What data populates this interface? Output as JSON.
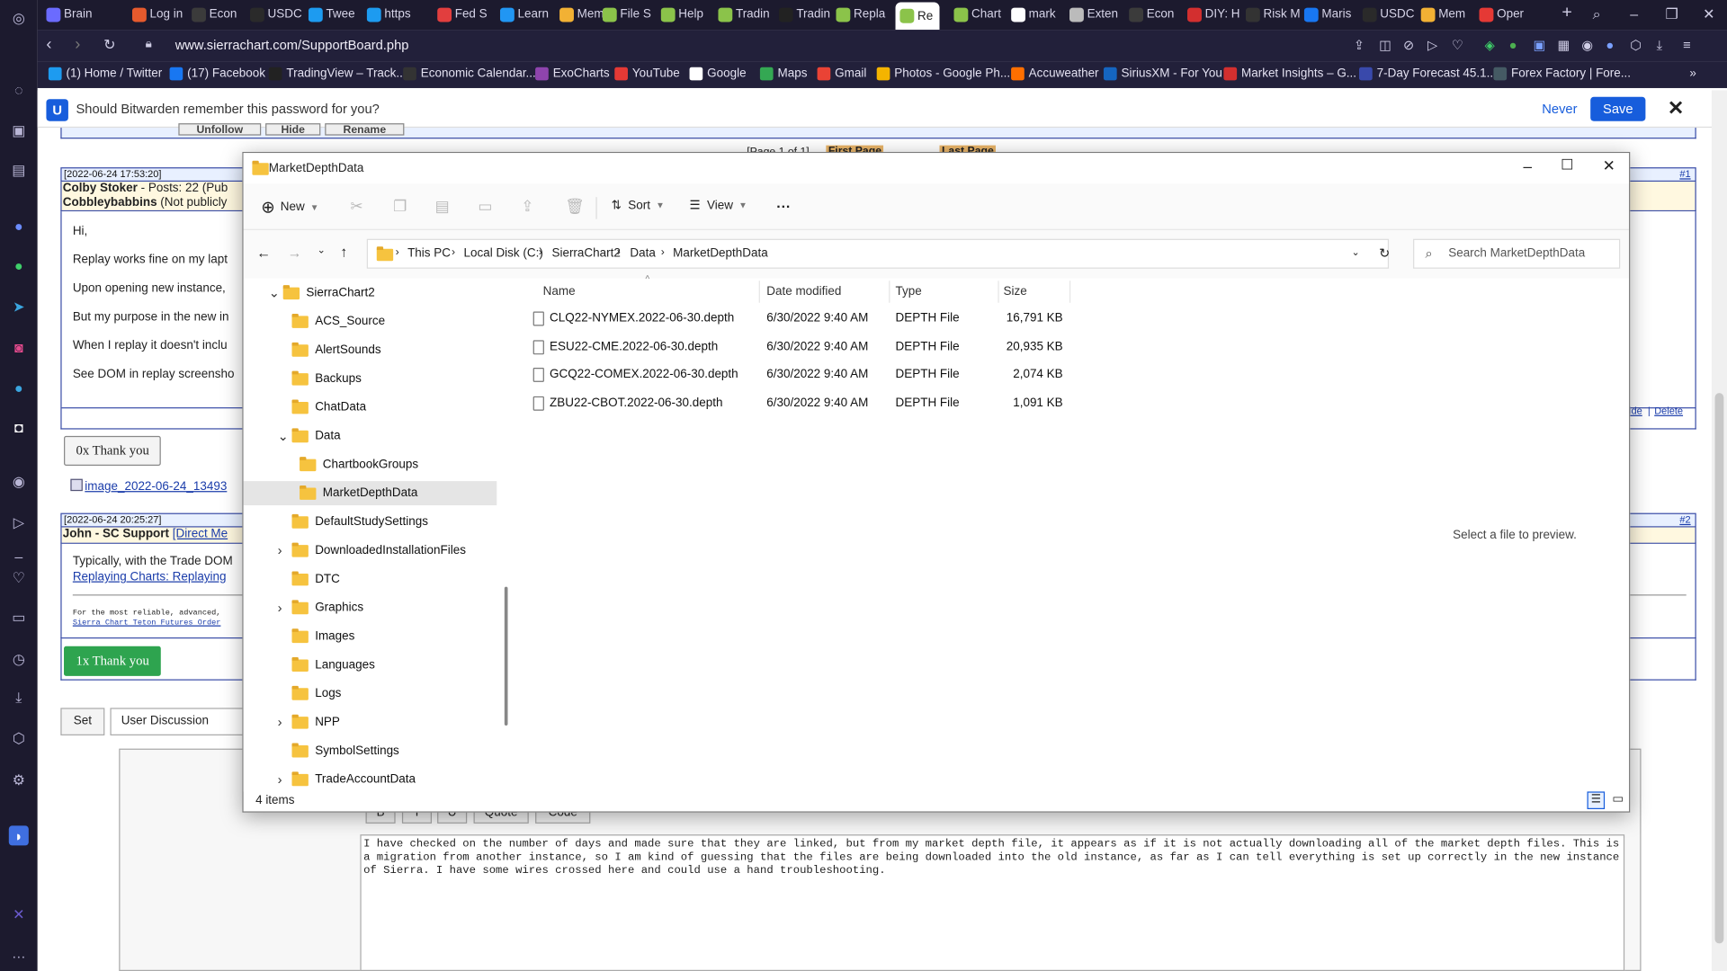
{
  "browser": {
    "tabs": [
      "Brain",
      "Log in",
      "Econ",
      "USDC",
      "Twee",
      "https",
      "Fed S",
      "Learn",
      "Mem",
      "File S",
      "Help",
      "Tradin",
      "Tradin",
      "Repla",
      "Re",
      "Chart",
      "mark",
      "Exten",
      "Econ",
      "DIY: H",
      "Risk M",
      "Maris",
      "USDC",
      "Mem",
      "Oper"
    ],
    "url": "www.sierrachart.com/SupportBoard.php",
    "bookmarks": [
      "(1) Home / Twitter",
      "(17) Facebook",
      "TradingView – Track...",
      "Economic Calendar...",
      "ExoCharts",
      "YouTube",
      "Google",
      "Maps",
      "Gmail",
      "Photos - Google Ph...",
      "Accuweather",
      "SiriusXM - For You",
      "Market Insights – G...",
      "7-Day Forecast 45.1...",
      "Forex Factory | Fore..."
    ]
  },
  "bitwarden": {
    "prompt": "Should Bitwarden remember this password for you?",
    "never_label": "Never",
    "save_label": "Save"
  },
  "page": {
    "top_buttons": [
      "Unfollow",
      "Hide",
      "Rename"
    ],
    "pagination": {
      "text": "[Page 1 of 1]",
      "first": "First Page",
      "last": "Last Page"
    },
    "post1": {
      "timestamp": "[2022-06-24 17:53:20]",
      "num": "#1",
      "author": "Colby Stoker",
      "author_meta": " - Posts: 22 (Pub",
      "author_line2": "Cobbleybabbins",
      "author_line2_meta": " (Not publicly",
      "lines": [
        "Hi,",
        "Replay works fine on my lapt",
        "Upon opening new instance,",
        "But my purpose in the new in",
        "When I replay it doesn't inclu",
        "See DOM in replay screensho"
      ],
      "actions": [
        "ide",
        "Delete"
      ],
      "thank_label": "0x Thank you",
      "attachment": "image_2022-06-24_13493"
    },
    "post2": {
      "timestamp": "[2022-06-24 20:25:27]",
      "num": "#2",
      "author": "John - SC Support",
      "author_link": "[Direct Me",
      "line1": "Typically, with the Trade DOM",
      "link": "Replaying Charts: Replaying",
      "footer1": "For the most reliable, advanced,",
      "footer2": "Sierra Chart Teton Futures Order",
      "thank_label": "1x Thank you"
    },
    "set_label": "Set",
    "select_value": "User Discussion",
    "editor_buttons": [
      "B",
      "I",
      "U",
      "Quote",
      "Code"
    ],
    "reply_text": "I have checked on the number of days and made sure that they are linked, but from my market depth file, it appears as if it is not actually downloading all of the market depth files.  This is a migration from another instance, so I am kind of guessing that the files are being downloaded into the old instance, as far as I can tell everything is set up correctly in the new instance of Sierra. I have some wires crossed here and could use a hand troubleshooting."
  },
  "explorer": {
    "title": "MarketDepthData",
    "commands": {
      "new": "New",
      "sort": "Sort",
      "view": "View",
      "more": "···"
    },
    "breadcrumb": [
      "This PC",
      "Local Disk (C:)",
      "SierraChart2",
      "Data",
      "MarketDepthData"
    ],
    "search_placeholder": "Search MarketDepthData",
    "tree": [
      "SierraChart2",
      "ACS_Source",
      "AlertSounds",
      "Backups",
      "ChatData",
      "Data",
      "ChartbookGroups",
      "MarketDepthData",
      "DefaultStudySettings",
      "DownloadedInstallationFiles",
      "DTC",
      "Graphics",
      "Images",
      "Languages",
      "Logs",
      "NPP",
      "SymbolSettings",
      "TradeAccountData"
    ],
    "columns": [
      "Name",
      "Date modified",
      "Type",
      "Size"
    ],
    "files": [
      {
        "name": "CLQ22-NYMEX.2022-06-30.depth",
        "date": "6/30/2022 9:40 AM",
        "type": "DEPTH File",
        "size": "16,791 KB"
      },
      {
        "name": "ESU22-CME.2022-06-30.depth",
        "date": "6/30/2022 9:40 AM",
        "type": "DEPTH File",
        "size": "20,935 KB"
      },
      {
        "name": "GCQ22-COMEX.2022-06-30.depth",
        "date": "6/30/2022 9:40 AM",
        "type": "DEPTH File",
        "size": "2,074 KB"
      },
      {
        "name": "ZBU22-CBOT.2022-06-30.depth",
        "date": "6/30/2022 9:40 AM",
        "type": "DEPTH File",
        "size": "1,091 KB"
      }
    ],
    "preview_text": "Select a file to preview.",
    "status": "4 items"
  },
  "colors": {
    "accent": "#175ddc",
    "thank_green": "#2ea44f",
    "folder": "#f6c33f",
    "selected": "#e5e5e5"
  }
}
